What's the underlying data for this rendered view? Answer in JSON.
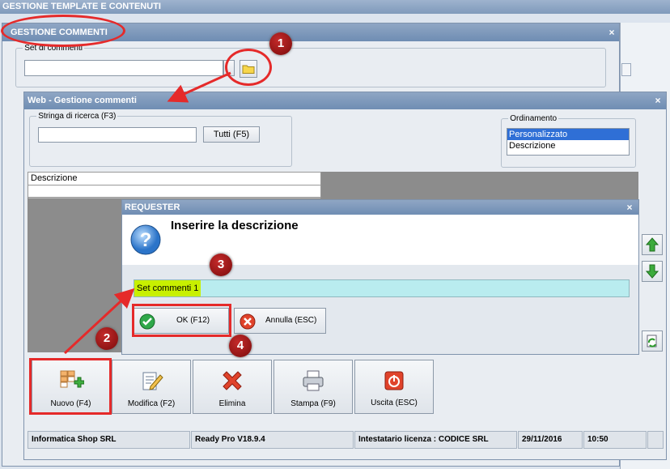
{
  "app": {
    "title": "GESTIONE TEMPLATE E CONTENUTI"
  },
  "gestione_commenti": {
    "title": "GESTIONE COMMENTI",
    "set_group_label": "Set di commenti",
    "set_value": ""
  },
  "web": {
    "title": "Web - Gestione commenti",
    "search_label": "Stringa di ricerca (F3)",
    "search_value": "",
    "all_button": "Tutti (F5)",
    "ordering_label": "Ordinamento",
    "ordering_options": [
      "Personalizzato",
      "Descrizione"
    ],
    "ordering_selected": "Personalizzato",
    "grid_header": "Descrizione"
  },
  "requester": {
    "title": "REQUESTER",
    "prompt": "Inserire la descrizione",
    "input_value": "Set commenti 1",
    "ok_button": "OK (F12)",
    "cancel_button": "Annulla (ESC)"
  },
  "toolbar": {
    "nuovo": "Nuovo (F4)",
    "modifica": "Modifica (F2)",
    "elimina": "Elimina",
    "stampa": "Stampa (F9)",
    "uscita": "Uscita (ESC)"
  },
  "status_bar": {
    "company": "Informatica Shop SRL",
    "version": "Ready Pro V18.9.4",
    "license": "Intestatario licenza : CODICE SRL",
    "date": "29/11/2016",
    "time": "10:50"
  },
  "annotations": {
    "marker_1": "1",
    "marker_2": "2",
    "marker_3": "3",
    "marker_4": "4"
  },
  "colors": {
    "annotation_red": "#e52a2a",
    "title_blue": "#6f8db3",
    "input_highlight": "#b9ecef",
    "text_highlight": "#c8f000",
    "selection": "#2f6fd6"
  },
  "close_symbol": "×"
}
